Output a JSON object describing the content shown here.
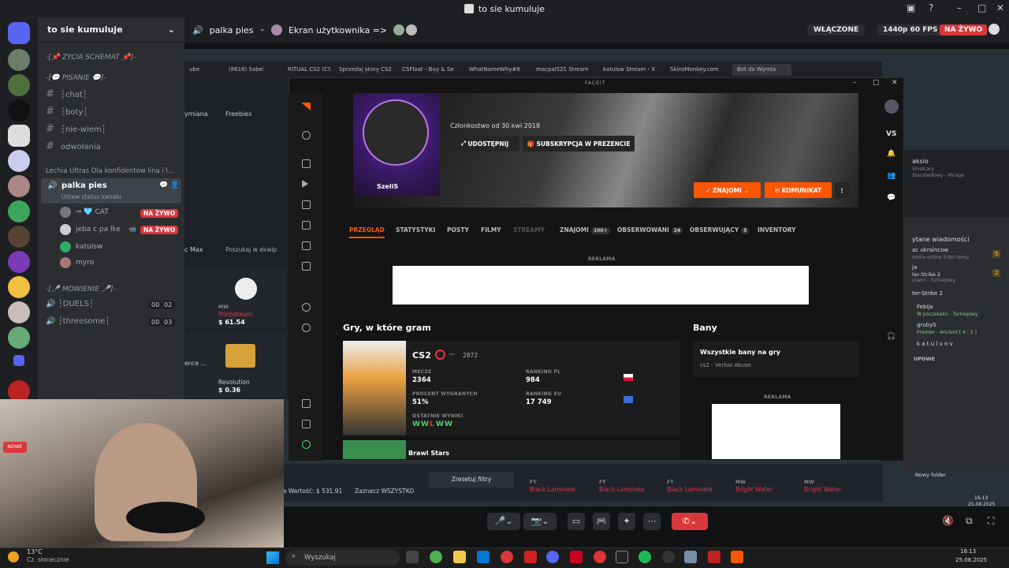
{
  "window": {
    "title": "to sie kumuluje"
  },
  "server": {
    "name": "to sie kumuluje"
  },
  "channels": {
    "cat1": "-[📌 ZYCIA SCHEMAT 📌]-",
    "cat2": "-[💬 PISANIE 💬]-",
    "ch1": "┆chat┆",
    "ch2": "┆boty┆",
    "ch3": "┆nie-wiem┆",
    "ch4": "odwołania",
    "cat3": "Lechia Ultras Dla konfidentow lina i l...",
    "voice_name": "palka pies",
    "voice_status": "Ustaw status kanału",
    "users": [
      {
        "name": "⇒ 🩵 CAT",
        "live": "NA ŻYWO"
      },
      {
        "name": "jeba c pa lke",
        "live": "NA ŻYWO"
      },
      {
        "name": "katulsw",
        "live": ""
      },
      {
        "name": "myro",
        "live": ""
      }
    ],
    "cat4": "-[🎤 MOWIENIE 🎤]-",
    "v1": "┆DUELS┆",
    "v1a": "00",
    "v1b": "02",
    "v2": "┆threesome┆",
    "v2a": "00",
    "v2b": "03"
  },
  "topbar": {
    "channel": "palka pies",
    "screen_label": "Ekran użytkownika =>",
    "enabled": "WŁĄCZONE",
    "quality": "1440p 60 FPS",
    "live": "NA ŻYWO"
  },
  "browser_tabs": [
    "ube",
    "(8616) Sobel \"Impr",
    "RITUAL CS2 (CSGC",
    "Sprzedaj skiny CS2",
    "CSFloat - Buy & Se",
    "WhatNameWhy#8",
    "macpal521 Stream",
    "katulsw Stream - X",
    "SkinsMonkey.com",
    "Bot do Wymia"
  ],
  "store": {
    "tab1": "ymiana",
    "tab2": "Freebies",
    "search": "Poszukaj w ekwip",
    "maxl": "c Max",
    "item1_wear": "MW",
    "item1_name": "Printstream",
    "item1_price": "$ 61.54",
    "item2_name": "Revolution",
    "item2_price": "$ 0.36",
    "item3_name": "ence ...",
    "total": "na Wartość: $ 531.91",
    "mark_all": "Zaznacz WSZYSTKO",
    "reset": "Zresetuj filtry",
    "bottom_items": [
      "Black Laminate",
      "Black Laminate",
      "Black Laminate",
      "Bright Water",
      "Bright Water"
    ],
    "bottom_wear": [
      "FT",
      "FT",
      "FT",
      "MW",
      "MW"
    ]
  },
  "faceit": {
    "brand": "FACEIT",
    "member_since": "Członkostwo od 30 kwi 2018",
    "share": "UDOSTĘPNIJ",
    "sub": "SUBSKRYPCJA W PREZENCIE",
    "nick": "SzeliS",
    "friends_btn": "ZNAJOMI",
    "message_btn": "KOMUNIKAT",
    "nav": [
      {
        "l": "PRZEGLĄD",
        "b": ""
      },
      {
        "l": "STATYSTYKI",
        "b": ""
      },
      {
        "l": "POSTY",
        "b": ""
      },
      {
        "l": "FILMY",
        "b": ""
      },
      {
        "l": "STREAMY",
        "b": ""
      },
      {
        "l": "ZNAJOMI",
        "b": "100+"
      },
      {
        "l": "OBSERWOWANI",
        "b": "24"
      },
      {
        "l": "OBSERWUJĄCY",
        "b": "5"
      },
      {
        "l": "INVENTORY",
        "b": ""
      }
    ],
    "ad": "REKLAMA",
    "games_title": "Gry, w które gram",
    "game": "CS2",
    "elo": "2872",
    "matches_l": "MECZE",
    "matches": "2364",
    "rank_pl_l": "RANKING PL",
    "rank_pl": "984",
    "win_l": "PROCENT WYGRANYCH",
    "win": "51%",
    "rank_eu_l": "RANKING EU",
    "rank_eu": "17 749",
    "last_l": "OSTATNIE WYNIKI",
    "last": [
      "W",
      "W",
      "L",
      "W",
      "W"
    ],
    "game2": "Brawl Stars",
    "bans_title": "Bany",
    "bans_all": "Wszystkie bany na gry",
    "bans_sub": "cs2 - Verbal Abuse",
    "vs": "VS"
  },
  "rightpanel": {
    "p1": "aksio",
    "p2": "Vindicary",
    "p3": "Standardowy - Mirage",
    "p4": "ytane wiadomości",
    "p5": "ac ukraincow",
    "p6": "ormio online 3 dni temu",
    "p7": "ja",
    "p8": "ter-Strike 2",
    "p9": "czalni - Turniejowy",
    "p10": "ter-Strike 2",
    "p11": "Febija",
    "p12": "W poczekalni - Turniejowy",
    "p13": "grubyS",
    "p14": "Premier - Ancient [ 4 : 2 ]",
    "p15": "k a t u l v n v",
    "p16": "UPOWE",
    "n1": "5",
    "n2": "2",
    "folder": "Nowy folder",
    "clock1": "16:13",
    "date1": "25.08.2025"
  },
  "taskbar": {
    "temp": "13°C",
    "weather": "Cz. słonecznie",
    "search": "Wyszukaj",
    "time": "16:13",
    "date": "25.08.2025"
  },
  "colors": {
    "faceit_orange": "#ff5500",
    "live_red": "#da373c",
    "win": "#4ad36b",
    "loss": "#e0344a"
  }
}
